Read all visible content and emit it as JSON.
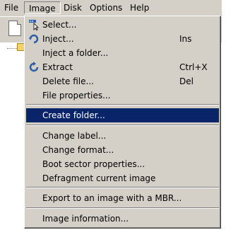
{
  "menubar": {
    "items": [
      "File",
      "Image",
      "Disk",
      "Options",
      "Help"
    ],
    "active": "Image"
  },
  "image_menu": {
    "items": [
      {
        "label": "Select...",
        "shortcut": "",
        "icon": "select-icon"
      },
      {
        "label": "Inject...",
        "shortcut": "Ins",
        "icon": "inject-icon"
      },
      {
        "label": "Inject a folder...",
        "shortcut": "",
        "icon": ""
      },
      {
        "label": "Extract",
        "shortcut": "Ctrl+X",
        "icon": "extract-icon"
      },
      {
        "label": "Delete file...",
        "shortcut": "Del",
        "icon": ""
      },
      {
        "label": "File properties...",
        "shortcut": "",
        "icon": ""
      },
      {
        "label": "Create folder...",
        "shortcut": "",
        "icon": "",
        "highlighted": true
      },
      {
        "label": "Change label...",
        "shortcut": "",
        "icon": ""
      },
      {
        "label": "Change format...",
        "shortcut": "",
        "icon": ""
      },
      {
        "label": "Boot sector properties...",
        "shortcut": "",
        "icon": ""
      },
      {
        "label": "Defragment current image",
        "shortcut": "",
        "icon": ""
      },
      {
        "label": "Export to an image with a MBR...",
        "shortcut": "",
        "icon": ""
      },
      {
        "label": "Image information...",
        "shortcut": "",
        "icon": ""
      }
    ]
  },
  "colors": {
    "menu_bg": "#d4d0c8",
    "highlight_bg": "#0a246a",
    "highlight_text": "#ffffff"
  }
}
